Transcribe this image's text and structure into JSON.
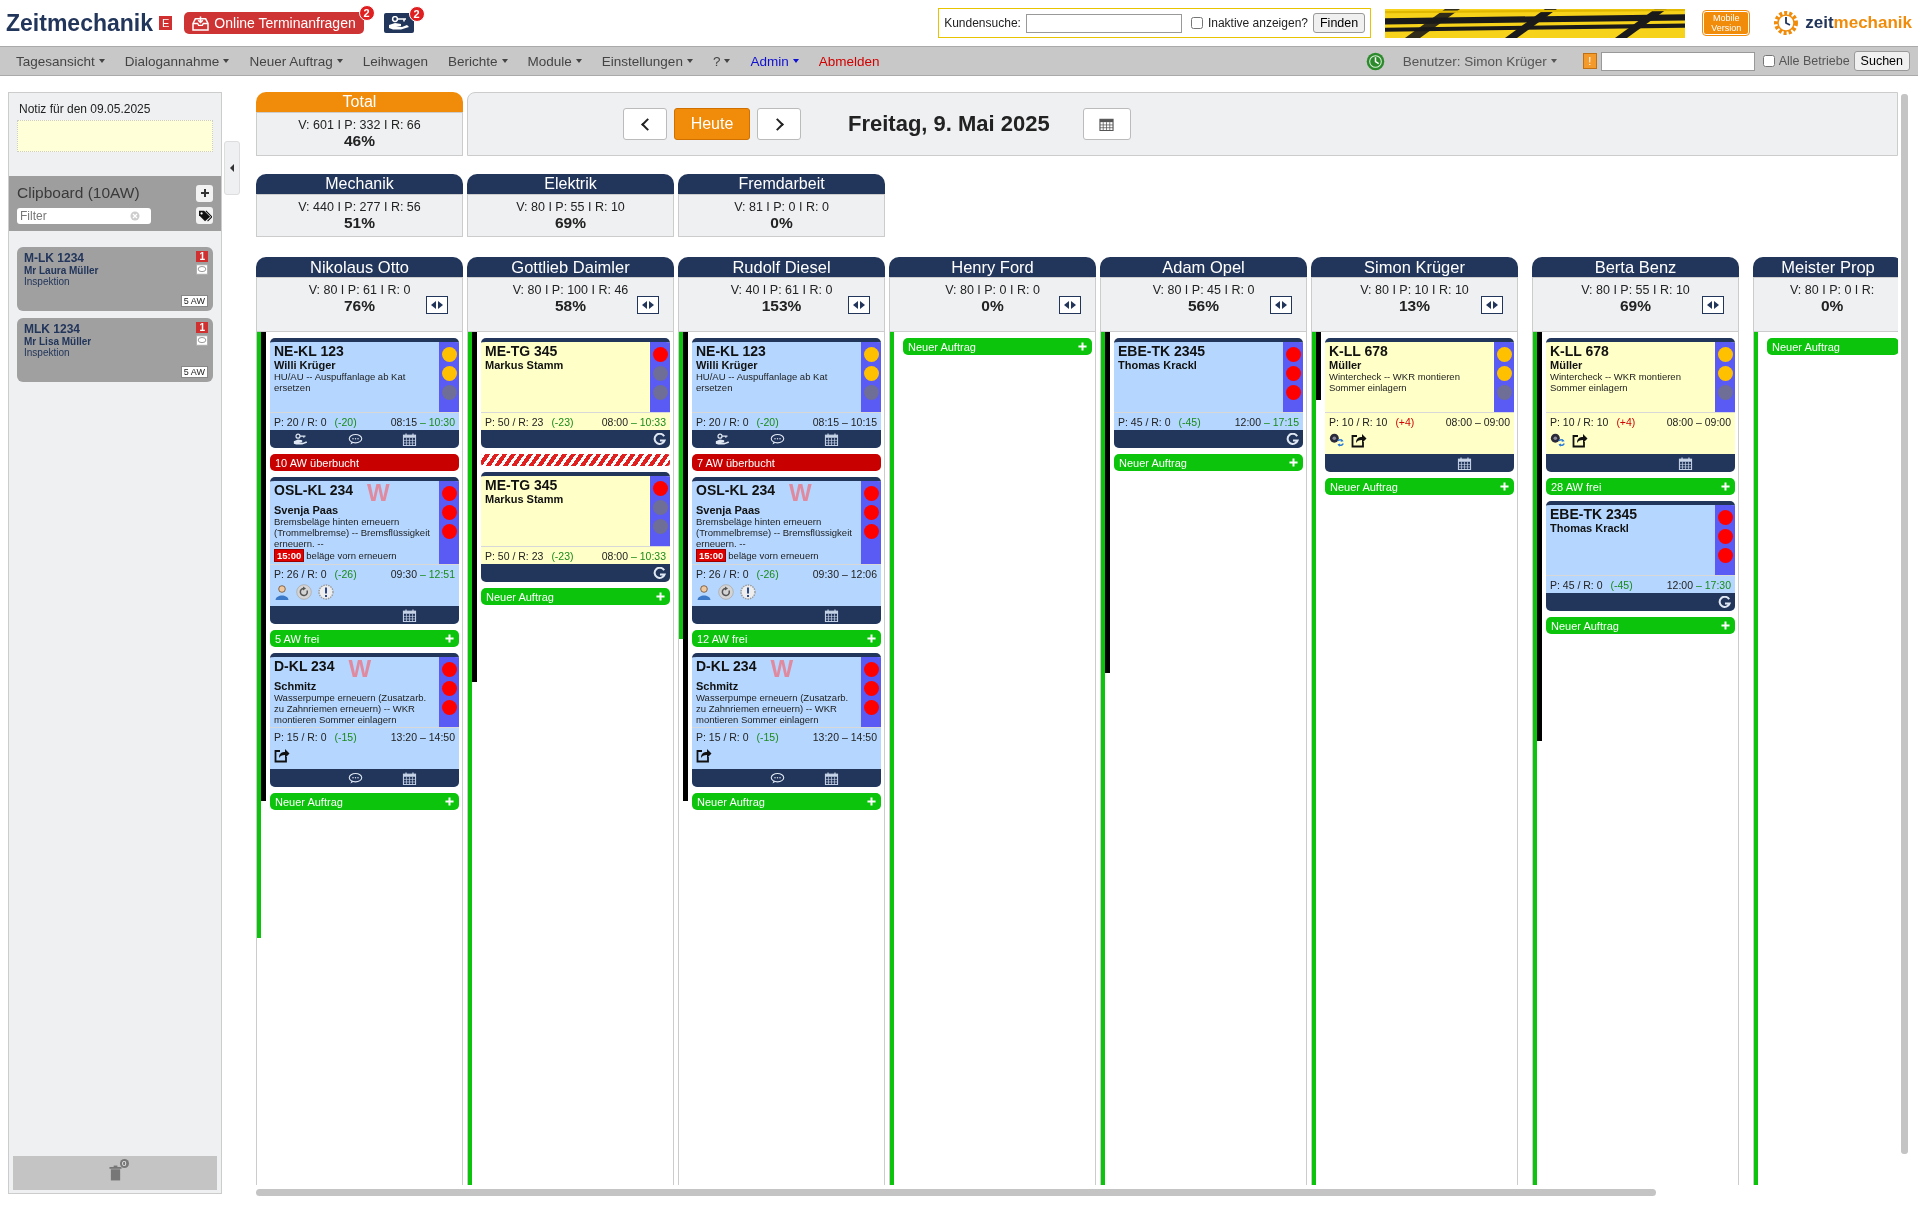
{
  "header": {
    "logo": "Zeitmechanik",
    "edition": "E",
    "online_requests": {
      "label": "Online Terminanfragen",
      "count": "2"
    },
    "key_requests": {
      "count": "2"
    },
    "customer_search": {
      "label": "Kundensuche:",
      "inactive_label": "Inaktive anzeigen?",
      "inactive_checked": false,
      "button": "Finden"
    },
    "mobile_button": "Mobile Version",
    "brand": {
      "first": "zeit",
      "second": "mechanik"
    }
  },
  "menu": [
    {
      "label": "Tagesansicht",
      "kind": "normal",
      "dropdown": true
    },
    {
      "label": "Dialogannahme",
      "kind": "normal",
      "dropdown": true
    },
    {
      "label": "Neuer Auftrag",
      "kind": "normal",
      "dropdown": true
    },
    {
      "label": "Leihwagen",
      "kind": "normal",
      "dropdown": false
    },
    {
      "label": "Berichte",
      "kind": "normal",
      "dropdown": true
    },
    {
      "label": "Module",
      "kind": "normal",
      "dropdown": true
    },
    {
      "label": "Einstellungen",
      "kind": "normal",
      "dropdown": true
    },
    {
      "label": "?",
      "kind": "normal",
      "dropdown": true
    },
    {
      "label": "Admin",
      "kind": "admin",
      "dropdown": true
    },
    {
      "label": "Abmelden",
      "kind": "logout",
      "dropdown": false
    }
  ],
  "menu_right": {
    "user": "Benutzer: Simon Krüger",
    "alert": "!",
    "all_label": "Alle Betriebe",
    "all_checked": false,
    "button": "Suchen"
  },
  "sidebar": {
    "note_label": "Notiz für den 09.05.2025",
    "clipboard_title": "Clipboard (10AW)",
    "filter_placeholder": "Filter",
    "items": [
      {
        "plate": "M-LK 1234",
        "customer": "Mr Laura Müller",
        "service": "Inspektion",
        "count": "1",
        "duration": "5 AW"
      },
      {
        "plate": "MLK 1234",
        "customer": "Mr Lisa Müller",
        "service": "Inspektion",
        "count": "1",
        "duration": "5 AW"
      }
    ],
    "trash_count": "0"
  },
  "total": {
    "title": "Total",
    "stats": "V: 601 I P: 332 I R: 66",
    "percent": "46%"
  },
  "date_nav": {
    "today": "Heute",
    "date": "Freitag, 9. Mai 2025"
  },
  "groups": [
    {
      "title": "Mechanik",
      "stats": "V: 440 I P: 277 I R: 56",
      "percent": "51%"
    },
    {
      "title": "Elektrik",
      "stats": "V: 80 I P: 55 I R: 10",
      "percent": "69%"
    },
    {
      "title": "Fremdarbeit",
      "stats": "V: 81 I P: 0 I R: 0",
      "percent": "0%"
    }
  ],
  "columns": [
    {
      "name": "Nikolaus Otto",
      "stats": "V: 80 I P: 61 I R: 0",
      "percent": "76%",
      "toggle": true,
      "separated": false,
      "availability": {
        "level": 0.71
      },
      "load": {
        "level": 0.55
      },
      "entries": [
        {
          "kind": "job",
          "plate": "NE-KL 123",
          "customer": "Willi Krüger",
          "description": "HU/AU -- Auspuffanlage ab Kat ersetzen",
          "color": "#b5d7ff",
          "lights": [
            {
              "color": "#ffc000"
            },
            {
              "color": "#ffc000"
            },
            {
              "color": "#6e6e96"
            }
          ],
          "plan": "P: 20 / R: 0",
          "delta": "(-20)",
          "over_budget": false,
          "start": "08:15",
          "end": "– 10:30",
          "end_late": true,
          "footer": [
            {
              "kind": "key"
            },
            {
              "kind": "comment"
            },
            {
              "kind": "calendar"
            }
          ]
        },
        {
          "kind": "overbooked",
          "label": "10 AW überbucht"
        },
        {
          "kind": "job",
          "plate": "OSL-KL 234",
          "customer": "Svenja Paas",
          "mark": "W",
          "description": "Bremsbeläge hinten erneuern (Trommelbremse) -- Bremsflüssigkeit erneuern. --",
          "deadline": "15:00",
          "description_tail": "beläge vorn erneuern",
          "color": "#b5d7ff",
          "lights": [
            {
              "color": "#ff0000"
            },
            {
              "color": "#ff0000"
            },
            {
              "color": "#ff0000"
            }
          ],
          "plan": "P: 26 / R: 0",
          "delta": "(-26)",
          "over_budget": false,
          "start": "09:30",
          "end": "– 12:51",
          "end_late": true,
          "badges": [
            {
              "kind": "person"
            },
            {
              "kind": "recheck"
            },
            {
              "kind": "alert"
            }
          ],
          "footer": [
            {
              "kind": "calendar"
            }
          ]
        },
        {
          "kind": "free",
          "label": "5 AW frei",
          "plus": true
        },
        {
          "kind": "job",
          "plate": "D-KL 234",
          "customer": "Schmitz",
          "mark": "W",
          "description": "Wasserpumpe erneuern (Zusatzarb. zu Zahnriemen erneuern) -- WKR montieren Sommer einlagern",
          "color": "#b5d7ff",
          "lights": [
            {
              "color": "#ff0000"
            },
            {
              "color": "#ff0000"
            },
            {
              "color": "#ff0000"
            }
          ],
          "plan": "P: 15 / R: 0",
          "delta": "(-15)",
          "over_budget": false,
          "start": "13:20",
          "end": "– 14:50",
          "end_late": false,
          "badges": [
            {
              "kind": "share"
            }
          ],
          "footer": [
            {
              "kind": "comment"
            },
            {
              "kind": "calendar"
            }
          ]
        },
        {
          "kind": "new",
          "label": "Neuer Auftrag",
          "plus": true
        }
      ]
    },
    {
      "name": "Gottlieb Daimler",
      "stats": "V: 80 I P: 100 I R: 46",
      "percent": "58%",
      "toggle": true,
      "separated": false,
      "availability": {
        "level": 1
      },
      "load": {
        "level": 0.41
      },
      "entries": [
        {
          "kind": "job",
          "plate": "ME-TG 345",
          "customer": "Markus Stamm",
          "color": "#ffffc8",
          "lights": [
            {
              "color": "#ff0000"
            },
            {
              "color": "#6e6e96"
            },
            {
              "color": "#6e6e96"
            }
          ],
          "plan": "P: 50 / R: 23",
          "delta": "(-23)",
          "over_budget": false,
          "start": "08:00",
          "end": "– 10:33",
          "end_late": true,
          "footer": [
            {
              "kind": "google"
            }
          ]
        },
        {
          "kind": "overlap"
        },
        {
          "kind": "job",
          "plate": "ME-TG 345",
          "customer": "Markus Stamm",
          "color": "#ffffc8",
          "lights": [
            {
              "color": "#ff0000"
            },
            {
              "color": "#6e6e96"
            },
            {
              "color": "#6e6e96"
            }
          ],
          "plan": "P: 50 / R: 23",
          "delta": "(-23)",
          "over_budget": false,
          "start": "08:00",
          "end": "– 10:33",
          "end_late": true,
          "footer": [
            {
              "kind": "google"
            }
          ]
        },
        {
          "kind": "new",
          "label": "Neuer Auftrag",
          "plus": true
        }
      ]
    },
    {
      "name": "Rudolf Diesel",
      "stats": "V: 40 I P: 61 I R: 0",
      "percent": "153%",
      "toggle": true,
      "separated": false,
      "availability": {
        "level": 0.36
      },
      "load": {
        "level": 0.55
      },
      "entries": [
        {
          "kind": "job",
          "plate": "NE-KL 123",
          "customer": "Willi Krüger",
          "description": "HU/AU -- Auspuffanlage ab Kat ersetzen",
          "color": "#b5d7ff",
          "lights": [
            {
              "color": "#ffc000"
            },
            {
              "color": "#ffc000"
            },
            {
              "color": "#6e6e96"
            }
          ],
          "plan": "P: 20 / R: 0",
          "delta": "(-20)",
          "over_budget": false,
          "start": "08:15",
          "end": "– 10:15",
          "end_late": false,
          "footer": [
            {
              "kind": "key"
            },
            {
              "kind": "comment"
            },
            {
              "kind": "calendar"
            }
          ]
        },
        {
          "kind": "overbooked",
          "label": "7 AW überbucht"
        },
        {
          "kind": "job",
          "plate": "OSL-KL 234",
          "customer": "Svenja Paas",
          "mark": "W",
          "description": "Bremsbeläge hinten erneuern (Trommelbremse) -- Bremsflüssigkeit erneuern. --",
          "deadline": "15:00",
          "description_tail": "beläge vorn erneuern",
          "color": "#b5d7ff",
          "lights": [
            {
              "color": "#ff0000"
            },
            {
              "color": "#ff0000"
            },
            {
              "color": "#ff0000"
            }
          ],
          "plan": "P: 26 / R: 0",
          "delta": "(-26)",
          "over_budget": false,
          "start": "09:30",
          "end": "– 12:06",
          "end_late": false,
          "badges": [
            {
              "kind": "person"
            },
            {
              "kind": "recheck"
            },
            {
              "kind": "alert"
            }
          ],
          "footer": [
            {
              "kind": "calendar"
            }
          ]
        },
        {
          "kind": "free",
          "label": "12 AW frei",
          "plus": true
        },
        {
          "kind": "job",
          "plate": "D-KL 234",
          "customer": "Schmitz",
          "mark": "W",
          "description": "Wasserpumpe erneuern (Zusatzarb. zu Zahnriemen erneuern) -- WKR montieren Sommer einlagern",
          "color": "#b5d7ff",
          "lights": [
            {
              "color": "#ff0000"
            },
            {
              "color": "#ff0000"
            },
            {
              "color": "#ff0000"
            }
          ],
          "plan": "P: 15 / R: 0",
          "delta": "(-15)",
          "over_budget": false,
          "start": "13:20",
          "end": "– 14:50",
          "end_late": false,
          "badges": [
            {
              "kind": "share"
            }
          ],
          "footer": [
            {
              "kind": "comment"
            },
            {
              "kind": "calendar"
            }
          ]
        },
        {
          "kind": "new",
          "label": "Neuer Auftrag",
          "plus": true
        }
      ]
    },
    {
      "name": "Henry Ford",
      "stats": "V: 80 I P: 0 I R: 0",
      "percent": "0%",
      "toggle": true,
      "separated": false,
      "availability": {
        "level": 1
      },
      "entries": [
        {
          "kind": "new",
          "label": "Neuer Auftrag",
          "plus": true
        }
      ]
    },
    {
      "name": "Adam Opel",
      "stats": "V: 80 I P: 45 I R: 0",
      "percent": "56%",
      "toggle": true,
      "separated": false,
      "availability": {
        "level": 1
      },
      "load": {
        "level": 0.4
      },
      "entries": [
        {
          "kind": "job",
          "plate": "EBE-TK 2345",
          "customer": "Thomas Krackl",
          "color": "#b5d7ff",
          "lights": [
            {
              "color": "#ff0000"
            },
            {
              "color": "#ff0000"
            },
            {
              "color": "#ff0000"
            }
          ],
          "plan": "P: 45 / R: 0",
          "delta": "(-45)",
          "over_budget": false,
          "start": "12:00",
          "end": "– 17:15",
          "end_late": true,
          "footer": [
            {
              "kind": "google"
            }
          ]
        },
        {
          "kind": "new",
          "label": "Neuer Auftrag",
          "plus": true
        }
      ]
    },
    {
      "name": "Simon Krüger",
      "stats": "V: 80 I P: 10 I R: 10",
      "percent": "13%",
      "toggle": true,
      "separated": false,
      "availability": {
        "level": 1
      },
      "load": {
        "level": 0.08
      },
      "entries": [
        {
          "kind": "job",
          "plate": "K-LL 678",
          "customer": "Müller",
          "description": "Wintercheck -- WKR montieren Sommer einlagern",
          "color": "#ffffc8",
          "lights": [
            {
              "color": "#ffc000"
            },
            {
              "color": "#ffc000"
            },
            {
              "color": "#6e6e96"
            }
          ],
          "plan": "P: 10 / R: 10",
          "delta": "(+4)",
          "over_budget": true,
          "start": "08:00",
          "end": "– 09:00",
          "end_late": false,
          "badges": [
            {
              "kind": "tire_swap"
            },
            {
              "kind": "share"
            }
          ],
          "footer": [
            {
              "kind": "calendar"
            }
          ]
        },
        {
          "kind": "new",
          "label": "Neuer Auftrag",
          "plus": true
        }
      ]
    },
    {
      "name": "Berta Benz",
      "stats": "V: 80 I P: 55 I R: 10",
      "percent": "69%",
      "toggle": true,
      "separated": true,
      "availability": {
        "level": 1
      },
      "load": {
        "level": 0.48
      },
      "entries": [
        {
          "kind": "job",
          "plate": "K-LL 678",
          "customer": "Müller",
          "description": "Wintercheck -- WKR montieren Sommer einlagern",
          "color": "#ffffc8",
          "lights": [
            {
              "color": "#ffc000"
            },
            {
              "color": "#ffc000"
            },
            {
              "color": "#6e6e96"
            }
          ],
          "plan": "P: 10 / R: 10",
          "delta": "(+4)",
          "over_budget": true,
          "start": "08:00",
          "end": "– 09:00",
          "end_late": false,
          "badges": [
            {
              "kind": "tire_swap"
            },
            {
              "kind": "share"
            }
          ],
          "footer": [
            {
              "kind": "calendar"
            }
          ]
        },
        {
          "kind": "free",
          "label": "28 AW frei",
          "plus": true
        },
        {
          "kind": "job",
          "plate": "EBE-TK 2345",
          "customer": "Thomas Krackl",
          "color": "#b5d7ff",
          "lights": [
            {
              "color": "#ff0000"
            },
            {
              "color": "#ff0000"
            },
            {
              "color": "#ff0000"
            }
          ],
          "plan": "P: 45 / R: 0",
          "delta": "(-45)",
          "over_budget": false,
          "start": "12:00",
          "end": "– 17:30",
          "end_late": true,
          "footer": [
            {
              "kind": "google"
            }
          ]
        },
        {
          "kind": "new",
          "label": "Neuer Auftrag",
          "plus": true
        }
      ]
    },
    {
      "name": "Meister Prop",
      "stats": "V: 80 I P: 0 I R:",
      "percent": "0%",
      "toggle": false,
      "separated": true,
      "cut": true,
      "availability": {
        "level": 1
      },
      "entries": [
        {
          "kind": "new",
          "label": "Neuer Auftrag",
          "plus": false
        }
      ]
    }
  ]
}
